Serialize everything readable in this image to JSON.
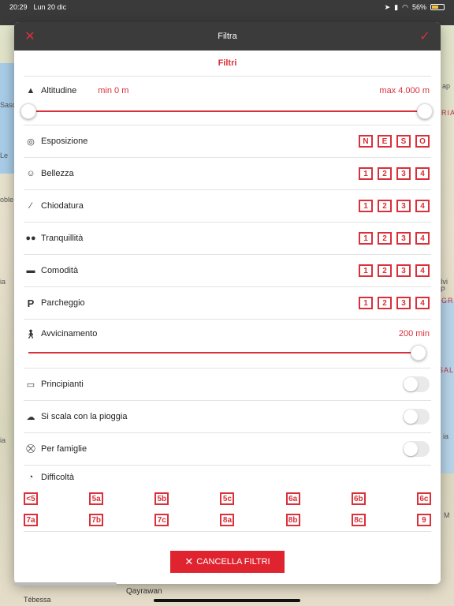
{
  "status_bar": {
    "time": "20:29",
    "date": "Lun 20 dic",
    "battery": "56%",
    "battery_level": 0.56
  },
  "map": {
    "labels_left": [
      "Sasc",
      "Le",
      "oble",
      "ia",
      "ia"
    ],
    "labels_right": [
      "ap",
      "RIA",
      "GR",
      "SALB",
      "Ivi P",
      "M",
      "ia"
    ],
    "bottom_labels": [
      "Qayrawan",
      "Tébessa"
    ]
  },
  "modal": {
    "title": "Filtra",
    "section_title": "Filtri",
    "altitude": {
      "label": "Altitudine",
      "min": "min 0 m",
      "max": "max 4.000 m",
      "range_min": 0,
      "range_max": 4000,
      "value_low": 0,
      "value_high": 4000
    },
    "exposure": {
      "label": "Esposizione",
      "options": [
        "N",
        "E",
        "S",
        "O"
      ]
    },
    "beauty": {
      "label": "Bellezza",
      "options": [
        "1",
        "2",
        "3",
        "4"
      ]
    },
    "bolting": {
      "label": "Chiodatura",
      "options": [
        "1",
        "2",
        "3",
        "4"
      ]
    },
    "quiet": {
      "label": "Tranquillità",
      "options": [
        "1",
        "2",
        "3",
        "4"
      ]
    },
    "comfort": {
      "label": "Comodità",
      "options": [
        "1",
        "2",
        "3",
        "4"
      ]
    },
    "parking": {
      "label": "Parcheggio",
      "options": [
        "1",
        "2",
        "3",
        "4"
      ]
    },
    "approach": {
      "label": "Avvicinamento",
      "value": "200 min",
      "fraction": 1.0
    },
    "beginners": {
      "label": "Principianti",
      "on": false
    },
    "rain": {
      "label": "Si scala con la pioggia",
      "on": false
    },
    "families": {
      "label": "Per famiglie",
      "on": false
    },
    "difficulty": {
      "label": "Difficoltà",
      "row1": [
        "<5",
        "5a",
        "5b",
        "5c",
        "6a",
        "6b",
        "6c"
      ],
      "row2": [
        "7a",
        "7b",
        "7c",
        "8a",
        "8b",
        "8c",
        "9"
      ]
    },
    "clear_button": "CANCELLA FILTRI"
  }
}
